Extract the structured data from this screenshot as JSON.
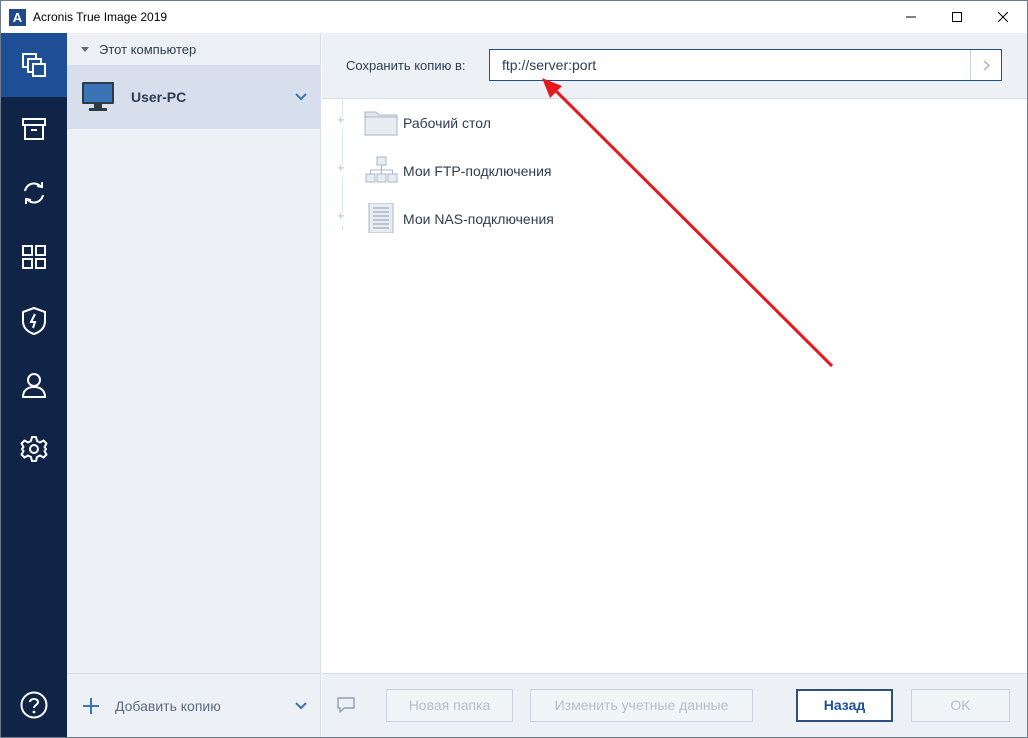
{
  "window": {
    "title": "Acronis True Image 2019",
    "logo_letter": "A"
  },
  "nav": {
    "items": [
      {
        "icon": "backup-icon",
        "active": true
      },
      {
        "icon": "archive-icon",
        "active": false
      },
      {
        "icon": "sync-icon",
        "active": false
      },
      {
        "icon": "tools-grid-icon",
        "active": false
      },
      {
        "icon": "shield-icon",
        "active": false
      },
      {
        "icon": "account-icon",
        "active": false
      },
      {
        "icon": "settings-gear-icon",
        "active": false
      }
    ],
    "help_icon": "help-icon"
  },
  "sources": {
    "header": "Этот компьютер",
    "selected_item": "User-PC",
    "add_copy_label": "Добавить копию"
  },
  "destination": {
    "label": "Сохранить копию в:",
    "path_value": "ftp://server:port"
  },
  "tree": [
    {
      "label": "Рабочий стол",
      "icon": "folder-icon"
    },
    {
      "label": "Мои FTP-подключения",
      "icon": "ftp-network-icon"
    },
    {
      "label": "Мои NAS-подключения",
      "icon": "nas-server-icon"
    }
  ],
  "buttons": {
    "new_folder": "Новая папка",
    "change_credentials": "Изменить учетные данные",
    "back": "Назад",
    "ok": "OK"
  },
  "colors": {
    "nav_bg": "#102447",
    "nav_active": "#1d4e96",
    "panel_bg": "#edf1f6",
    "annotation_arrow": "#e8191e"
  }
}
